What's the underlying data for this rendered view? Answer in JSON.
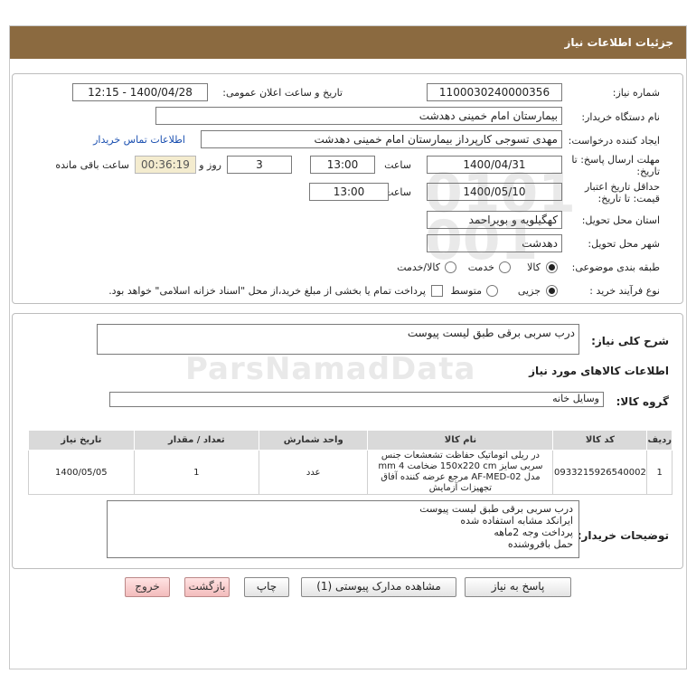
{
  "header": {
    "title": "جزئیات اطلاعات نیاز"
  },
  "form": {
    "need_number_label": "شماره نیاز:",
    "need_number": "1100030240000356",
    "announce_label": "تاریخ و ساعت اعلان عمومی:",
    "announce_value": "1400/04/28 - 12:15",
    "buyer_org_label": "نام دستگاه خریدار:",
    "buyer_org": "بیمارستان امام خمینی دهدشت",
    "requester_label": "ایجاد کننده درخواست:",
    "requester": "مهدی تسوجی کارپرداز بیمارستان امام خمینی دهدشت",
    "contact_link": "اطلاعات تماس خریدار",
    "deadline_label_1": "مهلت ارسال پاسخ: تا",
    "deadline_label_2": "تاریخ:",
    "deadline_date": "1400/04/31",
    "time_label": "ساعت",
    "deadline_time": "13:00",
    "days_value": "3",
    "days_label": "روز و",
    "remaining_time": "00:36:19",
    "remaining_label": "ساعت باقی مانده",
    "validity_label_1": "حداقل تاریخ اعتبار",
    "validity_label_2": "قیمت: تا تاریخ:",
    "validity_date": "1400/05/10",
    "validity_time": "13:00",
    "province_label": "استان محل تحویل:",
    "province": "کهگیلویه و بویراحمد",
    "city_label": "شهر محل تحویل:",
    "city": "دهدشت",
    "category_label": "طبقه بندی موضوعی:",
    "category_options": [
      "کالا",
      "خدمت",
      "کالا/خدمت"
    ],
    "process_label": "نوع فرآیند خرید :",
    "process_options": [
      "جزیی",
      "متوسط"
    ],
    "payment_note": "پرداخت تمام یا بخشی از مبلغ خرید،از محل \"اسناد خزانه اسلامی\" خواهد بود."
  },
  "details": {
    "summary_label": "شرح کلی نیاز:",
    "summary": "درب سربی برقی طبق لیست پیوست",
    "goods_info_title": "اطلاعات کالاهای مورد نیاز",
    "group_label": "گروه کالا:",
    "group_value": "وسایل خانه",
    "table": {
      "headers": [
        "ردیف",
        "کد کالا",
        "نام کالا",
        "واحد شمارش",
        "تعداد / مقدار",
        "تاریخ نیاز"
      ],
      "rows": [
        {
          "row": "1",
          "code": "0933215926540002",
          "name": "در ریلی اتوماتیک حفاظت تشعشعات جنس سربی سایز 150x220 cm ضخامت 4 mm مدل AF-MED-02 مرجع عرضه کننده آفاق تجهیزات آزمایش",
          "unit": "عدد",
          "qty": "1",
          "date": "1400/05/05"
        }
      ]
    },
    "buyer_desc_label": "توضیحات خریدار:",
    "buyer_desc_lines": [
      "درب سربی برقی طبق لیست پیوست",
      "ایرانکد مشابه استفاده شده",
      "پرداخت وجه 2ماهه",
      "حمل بافروشنده"
    ]
  },
  "buttons": {
    "reply": "پاسخ به نیاز",
    "attachments": "مشاهده مدارک پیوستی (1)",
    "print": "چاپ",
    "back": "بازگشت",
    "exit": "خروج"
  }
}
